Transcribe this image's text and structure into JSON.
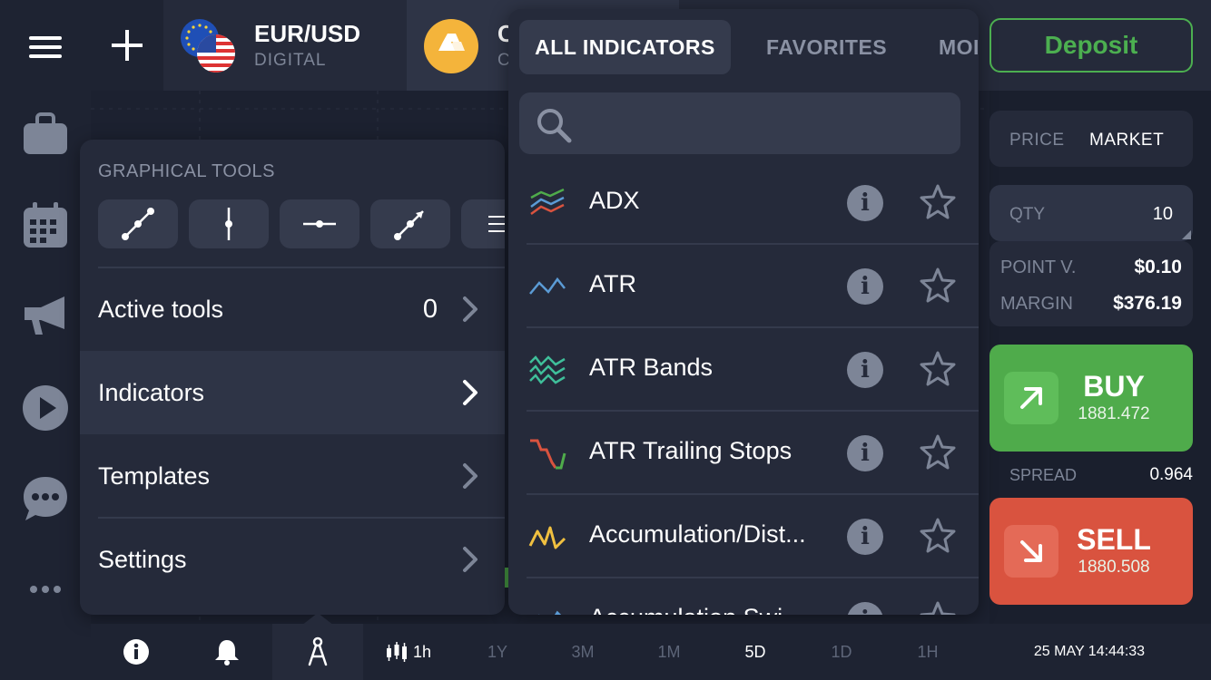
{
  "top": {
    "assets": [
      {
        "name": "EUR/USD",
        "sub": "DIGITAL"
      },
      {
        "name": "C",
        "sub": "C"
      }
    ],
    "deposit_label": "Deposit"
  },
  "tools_panel": {
    "title": "GRAPHICAL TOOLS",
    "rows": [
      {
        "label": "Active tools",
        "count": "0"
      },
      {
        "label": "Indicators"
      },
      {
        "label": "Templates"
      },
      {
        "label": "Settings"
      }
    ]
  },
  "indicators_panel": {
    "tabs": [
      "ALL INDICATORS",
      "FAVORITES",
      "MOI"
    ],
    "search_placeholder": "",
    "items": [
      {
        "name": "ADX",
        "icon": "adx-icon"
      },
      {
        "name": "ATR",
        "icon": "atr-icon"
      },
      {
        "name": "ATR Bands",
        "icon": "atr-bands-icon"
      },
      {
        "name": "ATR Trailing Stops",
        "icon": "atr-trailing-stops-icon"
      },
      {
        "name": "Accumulation/Dist...",
        "icon": "accumulation-distribution-icon"
      },
      {
        "name": "Accumulation Swi...",
        "icon": "accumulation-swing-icon"
      }
    ]
  },
  "trade_panel": {
    "price_tab": "PRICE",
    "market_tab": "MARKET",
    "qty_label": "QTY",
    "qty_value": "10",
    "point_value_label": "POINT V.",
    "point_value": "$0.10",
    "margin_label": "MARGIN",
    "margin_value": "$376.19",
    "buy_label": "BUY",
    "buy_price": "1881.472",
    "spread_label": "SPREAD",
    "spread_value": "0.964",
    "sell_label": "SELL",
    "sell_price": "1880.508"
  },
  "bottom_bar": {
    "candle_interval": "1h",
    "periods": [
      "1Y",
      "3M",
      "1M",
      "5D",
      "1D",
      "1H"
    ],
    "active_period": "5D",
    "datetime": "25 MAY 14:44:33"
  },
  "colors": {
    "buy": "#4fab4b",
    "sell": "#d9533f",
    "deposit": "#4caf50",
    "panel": "#252a3a"
  }
}
